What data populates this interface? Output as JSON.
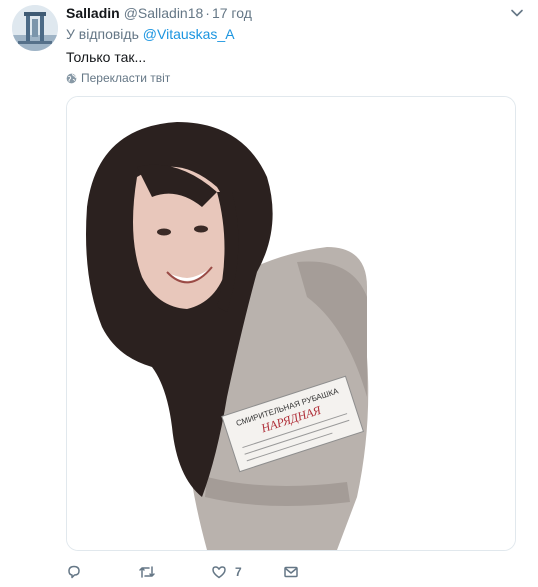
{
  "tweet": {
    "display_name": "Salladin",
    "handle": "@Salladin18",
    "separator": "·",
    "time": "17 год",
    "reply_prefix": "У відповідь",
    "reply_handle": "@Vitauskas_A",
    "text": "Только так...",
    "translate_label": "Перекласти твіт"
  },
  "media": {
    "shirt_label_line1": "СМИРИТЕЛЬНАЯ РУБАШКА",
    "shirt_label_line2": "НАРЯДНАЯ"
  },
  "actions": {
    "likes_count": "7"
  },
  "icons": {
    "avatar": "avatar-image",
    "caret": "chevron-down-icon",
    "translate": "globe-icon",
    "reply": "reply-icon",
    "retweet": "retweet-icon",
    "like": "heart-icon",
    "dm": "envelope-icon"
  },
  "colors": {
    "link": "#1b95e0",
    "muted": "#657786",
    "text": "#14171a",
    "border": "#e1e8ed"
  }
}
